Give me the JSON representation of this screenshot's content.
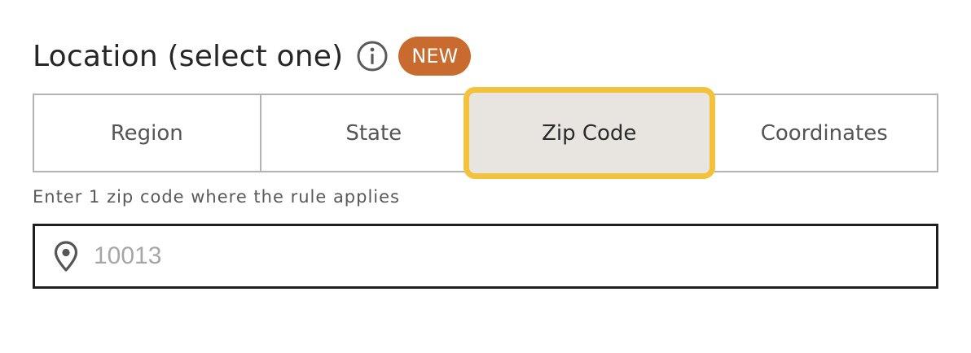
{
  "header": {
    "title": "Location (select one)",
    "info_icon": "info-circle-icon",
    "badge": "NEW",
    "badge_color": "#c96a2e"
  },
  "tabs": [
    {
      "label": "Region",
      "selected": false
    },
    {
      "label": "State",
      "selected": false
    },
    {
      "label": "Zip Code",
      "selected": true
    },
    {
      "label": "Coordinates",
      "selected": false
    }
  ],
  "helper_text": "Enter 1 zip code where the rule applies",
  "zip_input": {
    "icon": "location-pin-icon",
    "value": "",
    "placeholder": "10013"
  },
  "colors": {
    "selected_outline": "#f3c13a",
    "selected_fill": "#e8e5e0",
    "tab_border": "#b3b3b3",
    "input_border": "#1f1f1f"
  }
}
